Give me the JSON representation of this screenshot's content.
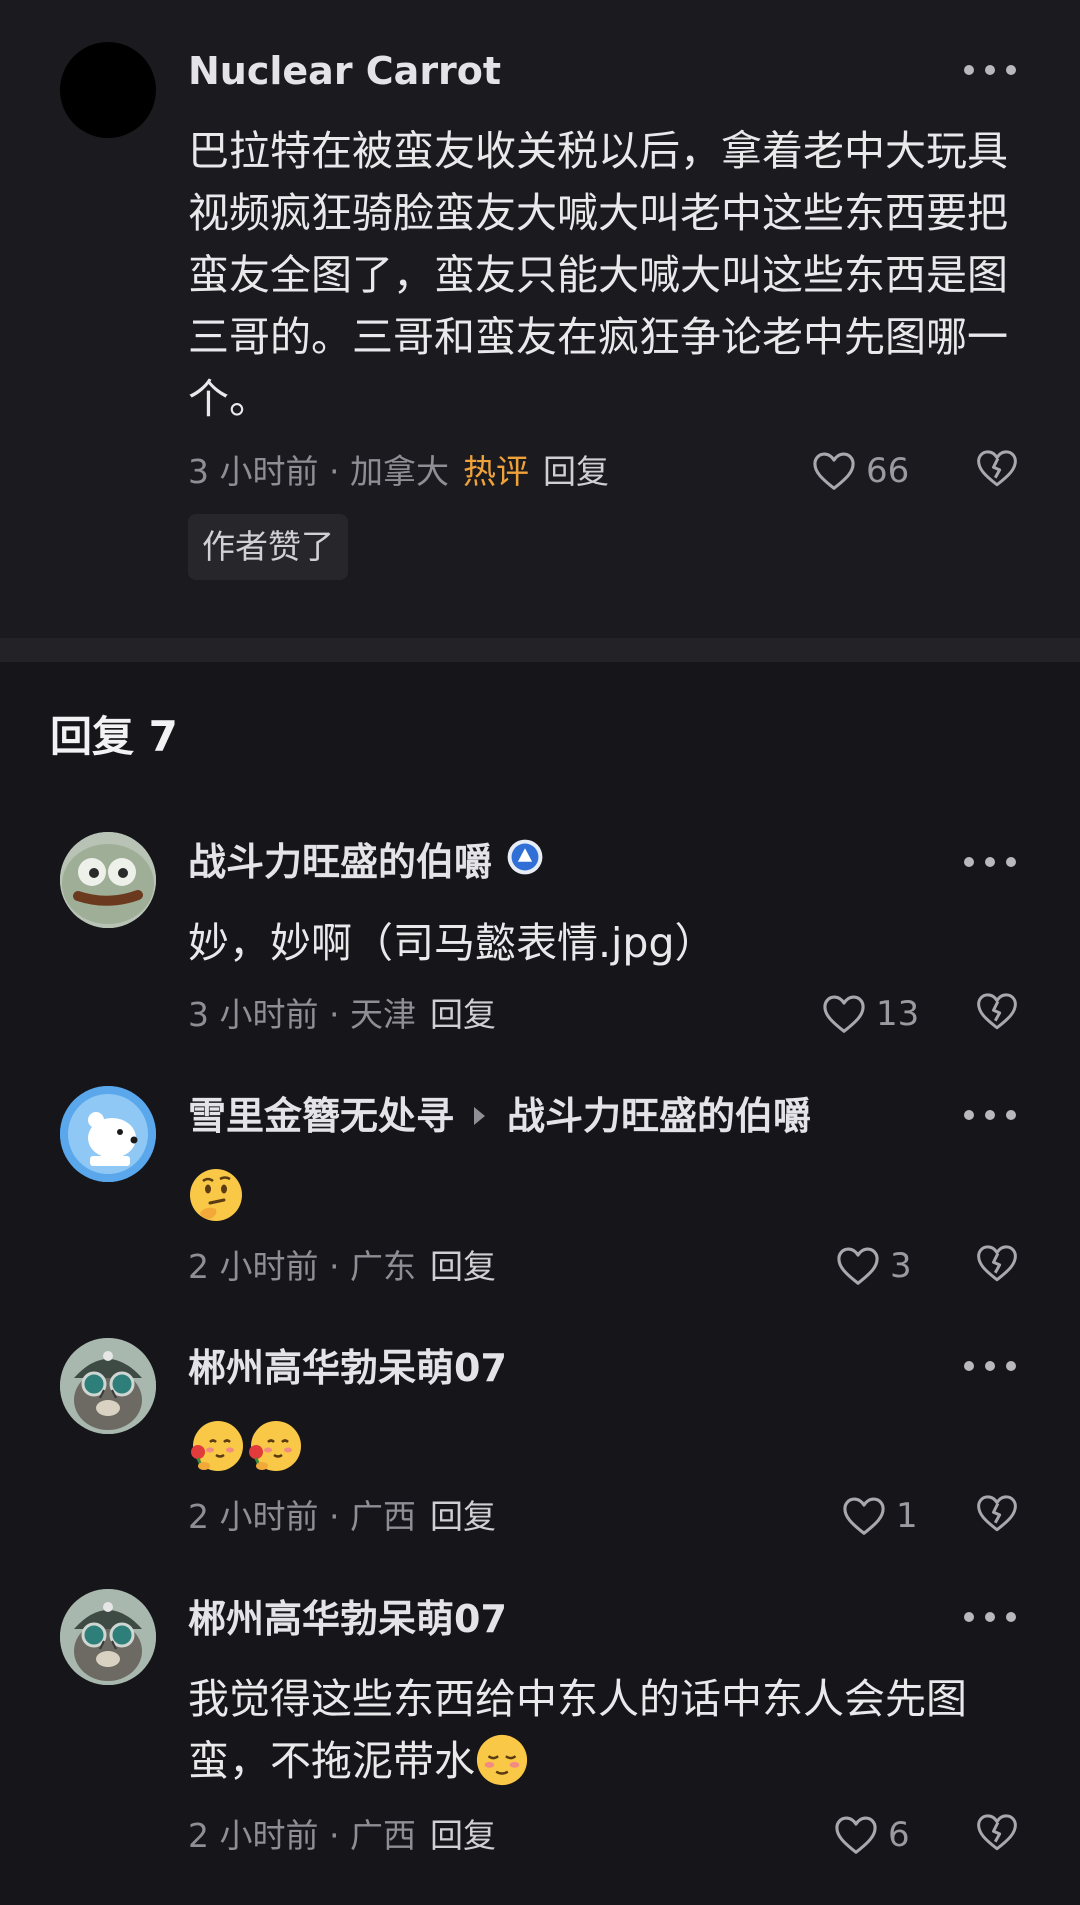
{
  "top_comment": {
    "username": "Nuclear Carrot",
    "text": "巴拉特在被蛮友收关税以后，拿着老中大玩具视频疯狂骑脸蛮友大喊大叫老中这些东西要把蛮友全图了，蛮友只能大喊大叫这些东西是图三哥的。三哥和蛮友在疯狂争论老中先图哪一个。",
    "time": "3 小时前",
    "location": "加拿大",
    "hot_tag": "热评",
    "reply_label": "回复",
    "likes": "66",
    "author_liked": "作者赞了"
  },
  "replies_header": "回复 7",
  "replies": [
    {
      "username": "战斗力旺盛的伯嚼",
      "verified": true,
      "text": "妙，妙啊（司马懿表情.jpg）",
      "time": "3 小时前",
      "location": "天津",
      "reply_label": "回复",
      "likes": "13",
      "avatar_icon": "pepe-face-avatar-icon"
    },
    {
      "username": "雪里金簪无处寻",
      "reply_to": "战斗力旺盛的伯嚼",
      "emoji": [
        "thinking-face-emoji"
      ],
      "time": "2 小时前",
      "location": "广东",
      "reply_label": "回复",
      "likes": "3",
      "avatar_icon": "white-bear-avatar-icon"
    },
    {
      "username": "郴州高华勃呆萌07",
      "emoji": [
        "face-holding-rose-emoji",
        "face-holding-rose-emoji"
      ],
      "time": "2 小时前",
      "location": "广西",
      "reply_label": "回复",
      "likes": "1",
      "avatar_icon": "cat-helmet-avatar-icon"
    },
    {
      "username": "郴州高华勃呆萌07",
      "text": "我觉得这些东西给中东人的话中东人会先图蛮，不拖泥带水",
      "emoji": [
        "relieved-face-emoji"
      ],
      "time": "2 小时前",
      "location": "广西",
      "reply_label": "回复",
      "likes": "6",
      "avatar_icon": "cat-helmet-avatar-icon"
    }
  ],
  "colors": {
    "background": "#16161a",
    "hot_tag": "#f0a23a",
    "muted_text": "#8e8e94"
  }
}
